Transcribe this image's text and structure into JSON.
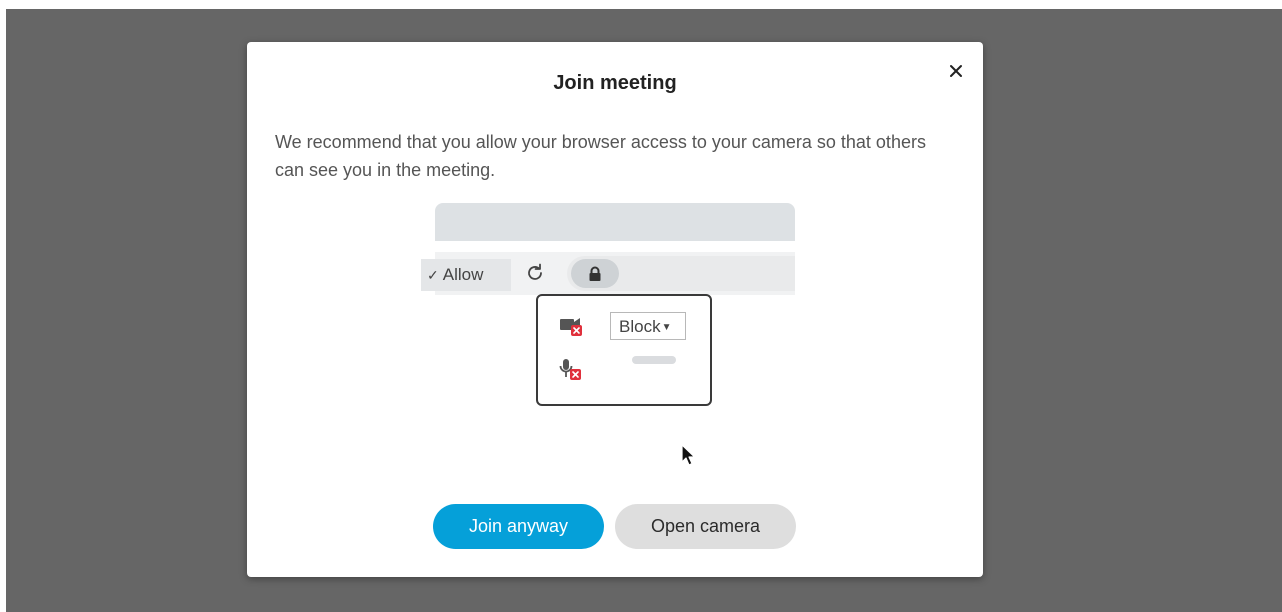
{
  "dialog": {
    "title": "Join meeting",
    "close_icon": "close-icon",
    "message": "We recommend that you allow your browser access to your camera so that others can see you in the meeting."
  },
  "illustration": {
    "icons": [
      "back-arrow-icon",
      "forward-arrow-icon",
      "reload-icon",
      "lock-icon",
      "camera-blocked-icon",
      "microphone-blocked-icon",
      "cursor-icon"
    ],
    "permission_select_value": "Block",
    "allow_option": "Allow"
  },
  "buttons": {
    "join_anyway": "Join anyway",
    "open_camera": "Open camera"
  },
  "colors": {
    "overlay": "#666666",
    "primary": "#05a0d9",
    "secondary": "#dedede",
    "blocked_badge": "#e0303c"
  }
}
